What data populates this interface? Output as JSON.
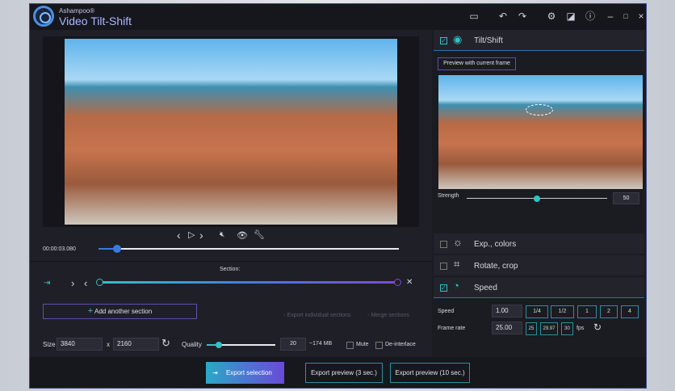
{
  "app": {
    "brand": "Ashampoo®",
    "title": "Video Tilt-Shift"
  },
  "player": {
    "timecode": "00:00:03.080",
    "progress": 0.04
  },
  "section": {
    "label": "Section:",
    "add_label": "Add another section",
    "export_individual": "Export individual sections",
    "merge": "Merge sections"
  },
  "output": {
    "size_label": "Size",
    "width": "3840",
    "x": "x",
    "height": "2160",
    "quality_label": "Quality",
    "quality": "20",
    "quality_fraction": 0.1,
    "filesize": "~174 MB",
    "mute": "Mute",
    "deinterlace": "De-interlace"
  },
  "footer": {
    "export_selection": "Export selection",
    "preview3": "Export preview (3 sec.)",
    "preview10": "Export preview (10 sec.)"
  },
  "panel": {
    "tiltshift": {
      "label": "Tilt/Shift",
      "preview_btn": "Preview with current frame",
      "strength_label": "Strength",
      "strength": "50",
      "strength_fraction": 0.5
    },
    "exp": {
      "label": "Exp., colors"
    },
    "rotate": {
      "label": "Rotate, crop"
    },
    "speed": {
      "label": "Speed",
      "speed_label": "Speed",
      "speed_value": "1.00",
      "speed_presets": [
        "1/4",
        "1/2",
        "1",
        "2",
        "4"
      ],
      "framerate_label": "Frame rate",
      "framerate_value": "25.00",
      "fps_presets": [
        "25",
        "29.97",
        "30"
      ],
      "fps_unit": "fps"
    }
  }
}
